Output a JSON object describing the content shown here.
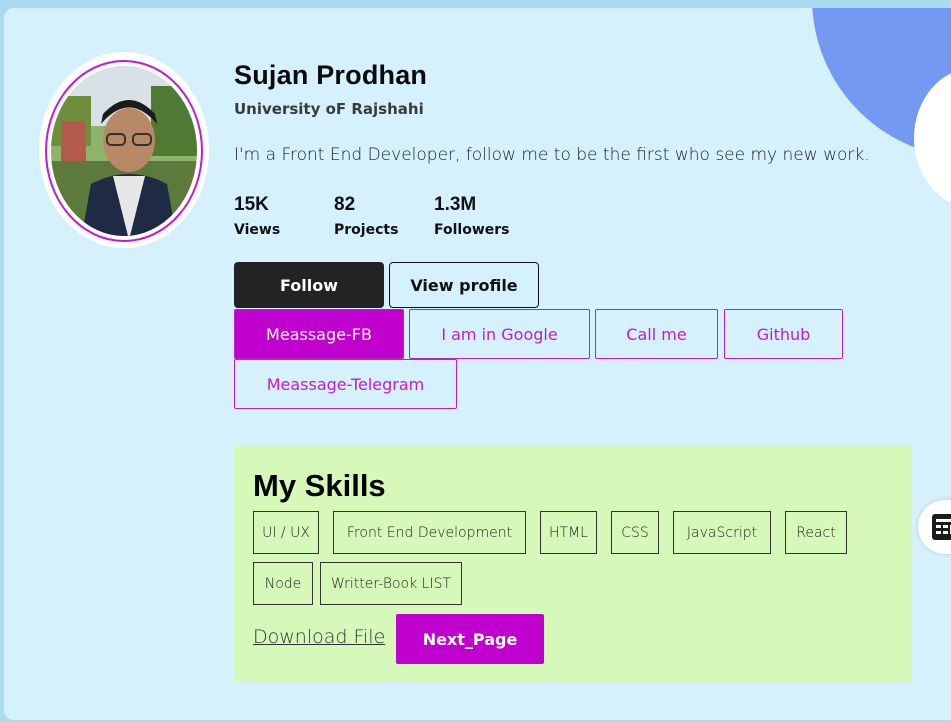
{
  "profile": {
    "name": "Sujan Prodhan",
    "university": "University oF Rajshahi",
    "bio": "I'm a Front End Developer, follow me to be the first who see my new work."
  },
  "stats": [
    {
      "value": "15K",
      "label": "Views"
    },
    {
      "value": "82",
      "label": "Projects"
    },
    {
      "value": "1.3M",
      "label": "Followers"
    }
  ],
  "actions": {
    "follow": "Follow",
    "view_profile": "View profile"
  },
  "social": [
    {
      "label": "Meassage-FB",
      "filled": true
    },
    {
      "label": "I am in Google",
      "filled": false
    },
    {
      "label": "Call me",
      "filled": false
    },
    {
      "label": "Github",
      "filled": false
    },
    {
      "label": "Meassage-Telegram",
      "filled": false
    }
  ],
  "skills": {
    "title": "My Skills",
    "tags": [
      "UI / UX",
      "Front End Development",
      "HTML",
      "CSS",
      "JavaScript",
      "React",
      "Node",
      "Writter-Book LIST"
    ],
    "download": "Download File",
    "next": "Next_Page"
  },
  "colors": {
    "accent": "#c000cc",
    "card_bg": "#d4f1fd",
    "skills_bg": "#d6f8b9",
    "blob": "#7499f3"
  },
  "icons": {
    "side_widget": "grid-widget-icon"
  }
}
